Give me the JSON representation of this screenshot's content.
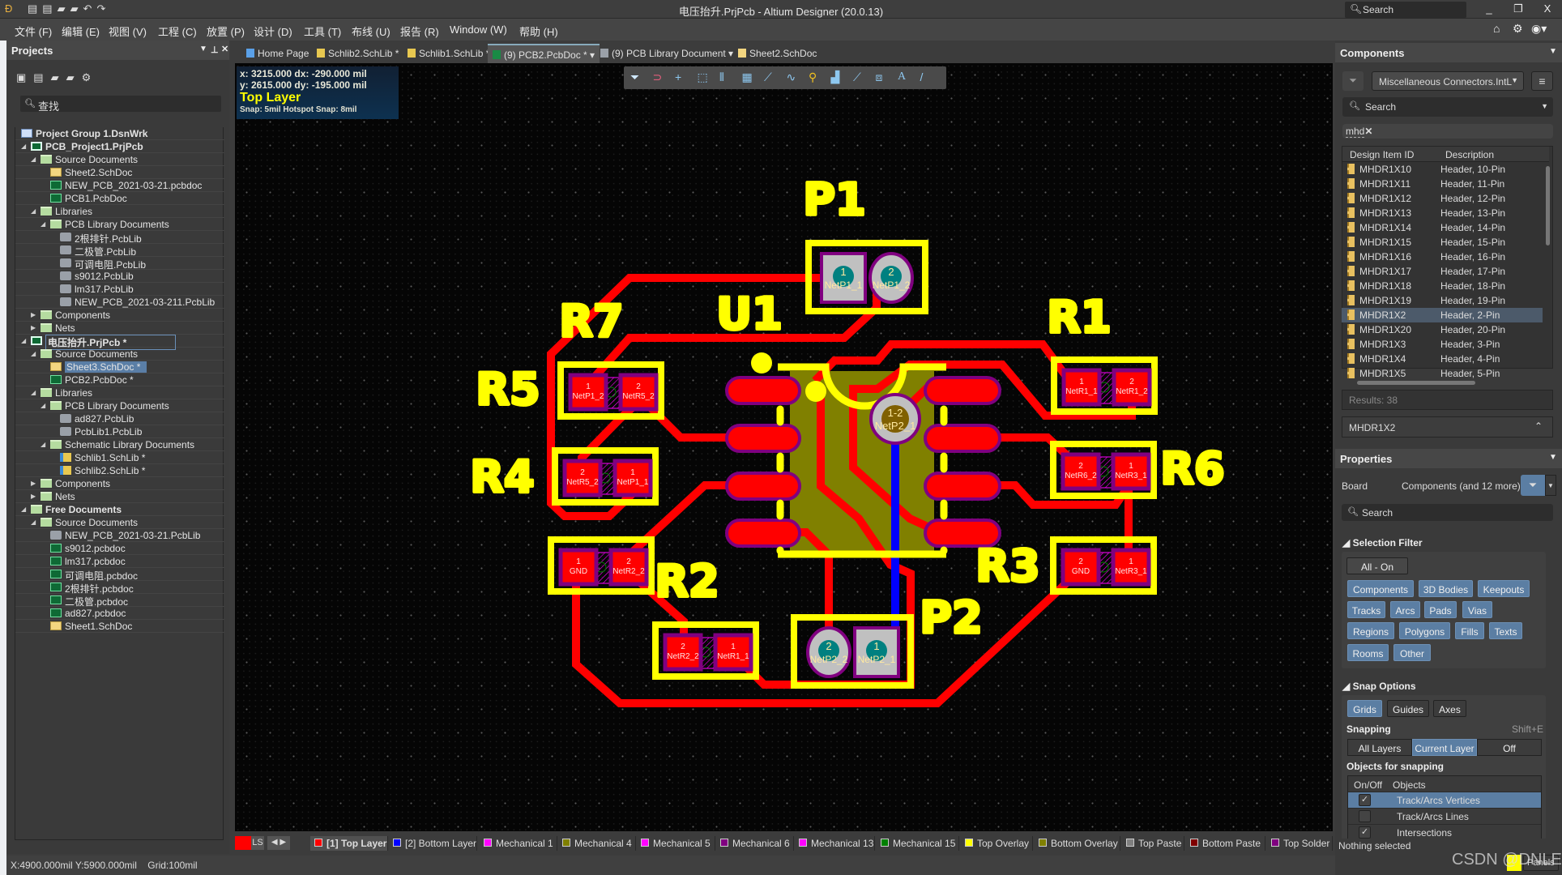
{
  "window": {
    "title": "电压抬升.PrjPcb - Altium Designer (20.0.13)",
    "search_placeholder": "Search",
    "minimize": "_",
    "restore": "❐",
    "close": "X"
  },
  "menu": [
    "文件 (F)",
    "编辑 (E)",
    "视图 (V)",
    "工程 (C)",
    "放置 (P)",
    "设计 (D)",
    "工具 (T)",
    "布线 (U)",
    "报告 (R)",
    "Window (W)",
    "帮助 (H)"
  ],
  "tabs": [
    {
      "label": "Home Page",
      "icon": "home-icon",
      "color": "#5aa0e8"
    },
    {
      "label": "Schlib2.SchLib *",
      "icon": "schlib-icon",
      "color": "#e8c850"
    },
    {
      "label": "Schlib1.SchLib *",
      "icon": "schlib-icon",
      "color": "#e8c850"
    },
    {
      "label": "(9) PCB2.PcbDoc *",
      "icon": "pcbdoc-icon",
      "color": "#1a8a45",
      "active": true,
      "dropdown": true
    },
    {
      "label": "(9) PCB Library Document",
      "icon": "pcblib-icon",
      "color": "#9aa0a8",
      "dropdown": true
    },
    {
      "label": "Sheet2.SchDoc",
      "icon": "schdoc-icon",
      "color": "#f3d680"
    }
  ],
  "projects": {
    "title": "Projects",
    "search_placeholder": "查找",
    "tree": [
      {
        "label": "Project Group 1.DsnWrk",
        "level": 0,
        "icon": "group",
        "bold": true
      },
      {
        "label": "PCB_Project1.PrjPcb",
        "level": 1,
        "icon": "prj",
        "expand": "open",
        "bold": true
      },
      {
        "label": "Source Documents",
        "level": 2,
        "icon": "folder",
        "expand": "open"
      },
      {
        "label": "Sheet2.SchDoc",
        "level": 3,
        "icon": "sch"
      },
      {
        "label": "NEW_PCB_2021-03-21.pcbdoc",
        "level": 3,
        "icon": "pcb"
      },
      {
        "label": "PCB1.PcbDoc",
        "level": 3,
        "icon": "pcb"
      },
      {
        "label": "Libraries",
        "level": 2,
        "icon": "folder",
        "expand": "open"
      },
      {
        "label": "PCB Library Documents",
        "level": 3,
        "icon": "folder",
        "expand": "open"
      },
      {
        "label": "2根排针.PcbLib",
        "level": 4,
        "icon": "lib"
      },
      {
        "label": "二极管.PcbLib",
        "level": 4,
        "icon": "lib"
      },
      {
        "label": "可调电阻.PcbLib",
        "level": 4,
        "icon": "lib"
      },
      {
        "label": "s9012.PcbLib",
        "level": 4,
        "icon": "lib"
      },
      {
        "label": "lm317.PcbLib",
        "level": 4,
        "icon": "lib"
      },
      {
        "label": "NEW_PCB_2021-03-211.PcbLib",
        "level": 4,
        "icon": "lib"
      },
      {
        "label": "Components",
        "level": 2,
        "icon": "folder",
        "expand": "closed"
      },
      {
        "label": "Nets",
        "level": 2,
        "icon": "folder",
        "expand": "closed"
      },
      {
        "label": "电压抬升.PrjPcb *",
        "level": 1,
        "icon": "prj",
        "expand": "open",
        "bold": true,
        "outlined": true
      },
      {
        "label": "Source Documents",
        "level": 2,
        "icon": "folder",
        "expand": "open"
      },
      {
        "label": "Sheet3.SchDoc *",
        "level": 3,
        "icon": "sch",
        "selected": true
      },
      {
        "label": "PCB2.PcbDoc *",
        "level": 3,
        "icon": "pcb"
      },
      {
        "label": "Libraries",
        "level": 2,
        "icon": "folder",
        "expand": "open"
      },
      {
        "label": "PCB Library Documents",
        "level": 3,
        "icon": "folder",
        "expand": "open"
      },
      {
        "label": "ad827.PcbLib",
        "level": 4,
        "icon": "lib"
      },
      {
        "label": "PcbLib1.PcbLib",
        "level": 4,
        "icon": "lib"
      },
      {
        "label": "Schematic Library Documents",
        "level": 3,
        "icon": "folder",
        "expand": "open"
      },
      {
        "label": "Schlib1.SchLib *",
        "level": 4,
        "icon": "schlib"
      },
      {
        "label": "Schlib2.SchLib *",
        "level": 4,
        "icon": "schlib"
      },
      {
        "label": "Components",
        "level": 2,
        "icon": "folder",
        "expand": "closed"
      },
      {
        "label": "Nets",
        "level": 2,
        "icon": "folder",
        "expand": "closed"
      },
      {
        "label": "Free Documents",
        "level": 1,
        "icon": "folder",
        "expand": "open",
        "bold": true
      },
      {
        "label": "Source Documents",
        "level": 2,
        "icon": "folder",
        "expand": "open"
      },
      {
        "label": "NEW_PCB_2021-03-21.PcbLib",
        "level": 3,
        "icon": "lib"
      },
      {
        "label": "s9012.pcbdoc",
        "level": 3,
        "icon": "pcb"
      },
      {
        "label": "lm317.pcbdoc",
        "level": 3,
        "icon": "pcb"
      },
      {
        "label": "可调电阻.pcbdoc",
        "level": 3,
        "icon": "pcb"
      },
      {
        "label": "2根排针.pcbdoc",
        "level": 3,
        "icon": "pcb"
      },
      {
        "label": "二极管.pcbdoc",
        "level": 3,
        "icon": "pcb"
      },
      {
        "label": "ad827.pcbdoc",
        "level": 3,
        "icon": "pcb"
      },
      {
        "label": "Sheet1.SchDoc",
        "level": 3,
        "icon": "sch"
      }
    ]
  },
  "hud": {
    "line1": "x:  3215.000   dx:  -290.000 mil",
    "line2": "y:  2615.000   dy:  -195.000 mil",
    "layer": "Top Layer",
    "snap": "Snap: 5mil Hotspot Snap: 8mil"
  },
  "pcb_toolbar": [
    "filter-icon",
    "interactive-routing-magnet-icon",
    "crosshair-icon",
    "select-rect-icon",
    "align-icon",
    "component-icon",
    "route-icon",
    "length-tune-icon",
    "via-icon",
    "region-icon",
    "track-icon",
    "dimension-icon",
    "text-icon",
    "line-icon"
  ],
  "pcb": {
    "designators": {
      "P1": "P1",
      "U1": "U1",
      "R7": "R7",
      "R1": "R1",
      "R5": "R5",
      "R4": "R4",
      "R2": "R2",
      "R6": "R6",
      "R3": "R3",
      "P2": "P2"
    },
    "resistors": [
      {
        "pads": [
          {
            "num": "1",
            "net": "NetP1_2"
          },
          {
            "num": "2",
            "net": "NetR5_2"
          }
        ]
      },
      {
        "pads": [
          {
            "num": "2",
            "net": "NetR5_2"
          },
          {
            "num": "1",
            "net": "NetP1_1"
          }
        ]
      },
      {
        "pads": [
          {
            "num": "1",
            "net": "GND"
          },
          {
            "num": "2",
            "net": "NetR2_2"
          }
        ]
      },
      {
        "pads": [
          {
            "num": "2",
            "net": "NetR2_2"
          },
          {
            "num": "1",
            "net": "NetR1_1"
          }
        ]
      },
      {
        "pads": [
          {
            "num": "1",
            "net": "NetR1_1"
          },
          {
            "num": "2",
            "net": "NetR1_2"
          }
        ]
      },
      {
        "pads": [
          {
            "num": "2",
            "net": "NetR6_2"
          },
          {
            "num": "1",
            "net": "NetR3_1"
          }
        ]
      },
      {
        "pads": [
          {
            "num": "2",
            "net": "GND"
          },
          {
            "num": "1",
            "net": "NetR3_1"
          }
        ]
      }
    ],
    "p1_pads": [
      {
        "num": "1",
        "net": "NetP1_1"
      },
      {
        "num": "2",
        "net": "NetP1_2"
      }
    ],
    "p2_pads": [
      {
        "num": "2",
        "net": "NetP2_2"
      },
      {
        "num": "1",
        "net": "NetP2_1"
      }
    ],
    "via": {
      "num": "1-2",
      "net": "NetP2_1"
    },
    "colors": {
      "top_layer": "#ff0000",
      "bottom_layer": "#0000ff",
      "overlay": "#ffff00",
      "body": "#808000",
      "pad_outline": "#800080",
      "through_pad": "#c0c0c0",
      "hole": "#008080"
    }
  },
  "layers": {
    "current_color": "#ff0000",
    "ls": "LS",
    "tabs": [
      {
        "label": "[1] Top Layer",
        "color": "#ff0000",
        "active": true
      },
      {
        "label": "[2] Bottom Layer",
        "color": "#0000ff"
      },
      {
        "label": "Mechanical 1",
        "color": "#ff00ff"
      },
      {
        "label": "Mechanical 4",
        "color": "#808000"
      },
      {
        "label": "Mechanical 5",
        "color": "#ff00ff"
      },
      {
        "label": "Mechanical 6",
        "color": "#800080"
      },
      {
        "label": "Mechanical 13",
        "color": "#ff00ff"
      },
      {
        "label": "Mechanical 15",
        "color": "#008000"
      },
      {
        "label": "Top Overlay",
        "color": "#ffff00"
      },
      {
        "label": "Bottom Overlay",
        "color": "#808000"
      },
      {
        "label": "Top Paste",
        "color": "#808080"
      },
      {
        "label": "Bottom Paste",
        "color": "#800000"
      },
      {
        "label": "Top Solder",
        "color": "#800080"
      }
    ]
  },
  "status": {
    "coords": "X:4900.000mil Y:5900.000mil",
    "grid": "Grid:100mil",
    "selection": "Nothing selected"
  },
  "components": {
    "title": "Components",
    "library": "Miscellaneous Connectors.IntL",
    "search_placeholder": "Search",
    "filter_tag": "mhd",
    "col_id": "Design Item ID",
    "col_desc": "Description",
    "rows": [
      [
        "MHDR1X10",
        "Header, 10-Pin"
      ],
      [
        "MHDR1X11",
        "Header, 11-Pin"
      ],
      [
        "MHDR1X12",
        "Header, 12-Pin"
      ],
      [
        "MHDR1X13",
        "Header, 13-Pin"
      ],
      [
        "MHDR1X14",
        "Header, 14-Pin"
      ],
      [
        "MHDR1X15",
        "Header, 15-Pin"
      ],
      [
        "MHDR1X16",
        "Header, 16-Pin"
      ],
      [
        "MHDR1X17",
        "Header, 17-Pin"
      ],
      [
        "MHDR1X18",
        "Header, 18-Pin"
      ],
      [
        "MHDR1X19",
        "Header, 19-Pin"
      ],
      [
        "MHDR1X2",
        "Header, 2-Pin"
      ],
      [
        "MHDR1X20",
        "Header, 20-Pin"
      ],
      [
        "MHDR1X3",
        "Header, 3-Pin"
      ],
      [
        "MHDR1X4",
        "Header, 4-Pin"
      ],
      [
        "MHDR1X5",
        "Header, 5-Pin"
      ]
    ],
    "selected_index": 10,
    "results": "Results: 38",
    "detail": "MHDR1X2"
  },
  "properties": {
    "title": "Properties",
    "board_label": "Board",
    "board_value": "Components (and 12 more)",
    "search_placeholder": "Search",
    "selection_filter": {
      "title": "Selection Filter",
      "all_on": "All - On",
      "buttons": [
        "Components",
        "3D Bodies",
        "Keepouts",
        "Tracks",
        "Arcs",
        "Pads",
        "Vias",
        "Regions",
        "Polygons",
        "Fills",
        "Texts",
        "Rooms",
        "Other"
      ]
    },
    "snap_options": {
      "title": "Snap Options",
      "modes": [
        {
          "label": "Grids",
          "on": true
        },
        {
          "label": "Guides",
          "on": false
        },
        {
          "label": "Axes",
          "on": false
        }
      ],
      "snapping_label": "Snapping",
      "snapping_shortcut": "Shift+E",
      "snapping": [
        {
          "label": "All Layers",
          "on": false
        },
        {
          "label": "Current Layer",
          "on": true
        },
        {
          "label": "Off",
          "on": false
        }
      ],
      "objects_title": "Objects for snapping",
      "col_onoff": "On/Off",
      "col_objects": "Objects",
      "objects": [
        {
          "label": "Track/Arcs Vertices",
          "checked": true,
          "selected": true
        },
        {
          "label": "Track/Arcs Lines",
          "checked": false
        },
        {
          "label": "Intersections",
          "checked": true
        }
      ]
    }
  },
  "panels_button": "Panels",
  "watermark": "CSDN @DNLE"
}
